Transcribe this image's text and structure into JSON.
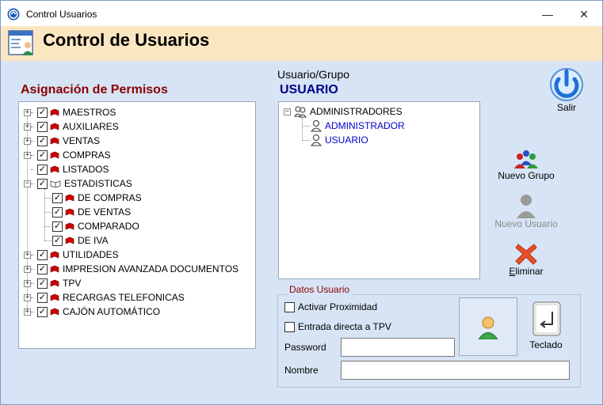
{
  "window": {
    "title": "Control Usuarios",
    "minimize_glyph": "—",
    "close_glyph": "✕"
  },
  "header": {
    "title": "Control de Usuarios"
  },
  "permissions": {
    "label": "Asignación de Permisos",
    "items": [
      {
        "label": "MAESTROS",
        "level": 0,
        "expander": "+",
        "checked": true,
        "icon": "book-icon"
      },
      {
        "label": "AUXILIARES",
        "level": 0,
        "expander": "+",
        "checked": true,
        "icon": "book-icon"
      },
      {
        "label": "VENTAS",
        "level": 0,
        "expander": "+",
        "checked": true,
        "icon": "book-icon"
      },
      {
        "label": "COMPRAS",
        "level": 0,
        "expander": "+",
        "checked": true,
        "icon": "book-icon"
      },
      {
        "label": "LISTADOS",
        "level": 0,
        "expander": "",
        "checked": true,
        "icon": "book-icon"
      },
      {
        "label": "ESTADISTICAS",
        "level": 0,
        "expander": "−",
        "checked": true,
        "icon": "open-book-icon"
      },
      {
        "label": "DE COMPRAS",
        "level": 1,
        "expander": "",
        "checked": true,
        "icon": "book-icon"
      },
      {
        "label": "DE VENTAS",
        "level": 1,
        "expander": "",
        "checked": true,
        "icon": "book-icon"
      },
      {
        "label": "COMPARADO",
        "level": 1,
        "expander": "",
        "checked": true,
        "icon": "book-icon"
      },
      {
        "label": "DE IVA",
        "level": 1,
        "expander": "",
        "checked": true,
        "icon": "book-icon"
      },
      {
        "label": "UTILIDADES",
        "level": 0,
        "expander": "+",
        "checked": true,
        "icon": "book-icon"
      },
      {
        "label": "IMPRESION AVANZADA DOCUMENTOS",
        "level": 0,
        "expander": "+",
        "checked": true,
        "icon": "book-icon"
      },
      {
        "label": "TPV",
        "level": 0,
        "expander": "+",
        "checked": true,
        "icon": "book-icon"
      },
      {
        "label": "RECARGAS TELEFONICAS",
        "level": 0,
        "expander": "+",
        "checked": true,
        "icon": "book-icon"
      },
      {
        "label": "CAJÓN  AUTOMÁTICO",
        "level": 0,
        "expander": "+",
        "checked": true,
        "icon": "book-icon"
      }
    ]
  },
  "user_group": {
    "label": "Usuario/Grupo",
    "value": "USUARIO",
    "tree": {
      "group": "ADMINISTRADORES",
      "group_expander": "−",
      "users": [
        "ADMINISTRADOR",
        "USUARIO"
      ]
    }
  },
  "actions": {
    "salir": "Salir",
    "nuevo_grupo": "Nuevo Grupo",
    "nuevo_usuario": "Nuevo Usuario",
    "eliminar_prefix": "E",
    "eliminar_rest": "liminar"
  },
  "datos_usuario": {
    "legend": "Datos Usuario",
    "activar_proximidad": {
      "label": "Activar Proximidad",
      "checked": false
    },
    "entrada_directa": {
      "label": "Entrada directa a TPV",
      "checked": false
    },
    "password_label": "Password",
    "password_value": "",
    "nombre_label": "Nombre",
    "nombre_value": "",
    "teclado": "Teclado"
  },
  "colors": {
    "window_bg": "#d6e4f5",
    "header_bg": "#fbe6c2",
    "section_red": "#8b0000",
    "navy": "#00008b",
    "link_blue": "#0000cc",
    "book_red": "#cc0000"
  }
}
